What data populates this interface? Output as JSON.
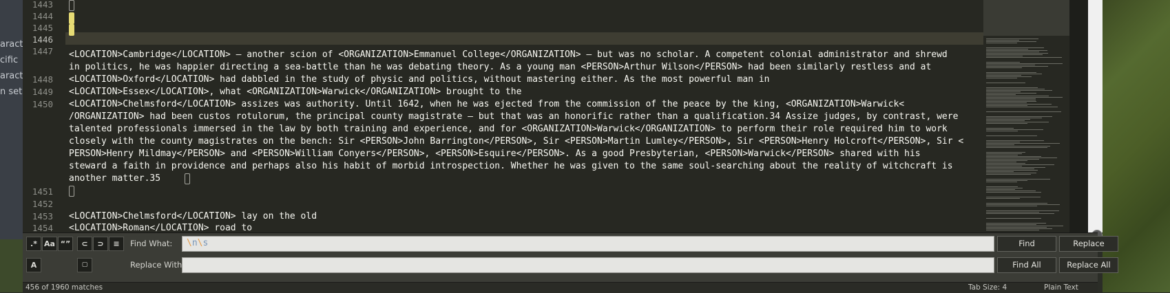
{
  "background_left": {
    "fragments": [
      "aracte",
      "cific",
      "aracte",
      "n sets"
    ]
  },
  "gutter": {
    "lines": [
      "1443",
      "1444",
      "1445",
      "1446",
      "1447",
      "",
      "1448",
      "1449",
      "1450",
      "",
      "",
      "",
      "",
      "",
      "",
      "",
      "1451",
      "1452",
      "1453",
      "1454"
    ],
    "active_line": "1446"
  },
  "editor": {
    "rows": [
      "",
      "",
      "",
      "",
      "<LOCATION>Cambridge</LOCATION> – another scion of <ORGANIZATION>Emmanuel College</ORGANIZATION> – but was no scholar. A competent colonial administrator and shrewd",
      "in politics, he was happier directing a sea-battle than he was debating theory. As a young man <PERSON>Arthur Wilson</PERSON> had been similarly restless and at",
      "<LOCATION>Oxford</LOCATION> had dabbled in the study of physic and politics, without mastering either. As the most powerful man in",
      "<LOCATION>Essex</LOCATION>, what <ORGANIZATION>Warwick</ORGANIZATION> brought to the",
      "<LOCATION>Chelmsford</LOCATION> assizes was authority. Until 1642, when he was ejected from the commission of the peace by the king, <ORGANIZATION>Warwick<",
      "/ORGANIZATION> had been custos rotulorum, the principal county magistrate – but that was an honorific rather than a qualification.34 Assize judges, by contrast, were",
      "talented professionals immersed in the law by both training and experience, and for <ORGANIZATION>Warwick</ORGANIZATION> to perform their role required him to work",
      "closely with the county magistrates on the bench: Sir <PERSON>John Barrington</PERSON>, Sir <PERSON>Martin Lumley</PERSON>, Sir <PERSON>Henry Holcroft</PERSON>, Sir <",
      "PERSON>Henry Mildmay</PERSON> and <PERSON>William Conyers</PERSON>, <PERSON>Esquire</PERSON>. As a good Presbyterian, <PERSON>Warwick</PERSON> shared with his",
      "steward a faith in providence and perhaps also his habit of morbid introspection. Whether he was given to the same soul-searching about the reality of witchcraft is",
      "another matter.35",
      "",
      "",
      "",
      "<LOCATION>Chelmsford</LOCATION> lay on the old",
      "<LOCATION>Roman</LOCATION> road to"
    ]
  },
  "find_panel": {
    "toggles": [
      {
        "name": "regex-toggle",
        "label": ".*"
      },
      {
        "name": "case-sensitive-toggle",
        "label": "Aa"
      },
      {
        "name": "whole-word-toggle",
        "label": "“”"
      },
      {
        "name": "wrap-toggle",
        "label": "⊂"
      },
      {
        "name": "in-selection-toggle",
        "label": "⊃"
      },
      {
        "name": "highlight-matches-toggle",
        "label": "≡"
      }
    ],
    "preserve_case_label": "A",
    "find_what_label": "Find What:",
    "find_what_value": "\\n\\s",
    "replace_with_label": "Replace With:",
    "replace_with_value": "",
    "buttons": {
      "find": "Find",
      "replace": "Replace",
      "find_all": "Find All",
      "replace_all": "Replace All"
    }
  },
  "status_bar": {
    "matches": "456 of 1960 matches",
    "tab_size": "Tab Size: 4",
    "syntax": "Plain Text"
  },
  "colors": {
    "editor_bg": "#272822",
    "text": "#f8f8f2",
    "line_number": "#8f908a",
    "match_marker": "#e6db74",
    "panel_bg": "#3b3c36",
    "regex_slash": "#e69b47",
    "regex_escape": "#7a96b8"
  }
}
